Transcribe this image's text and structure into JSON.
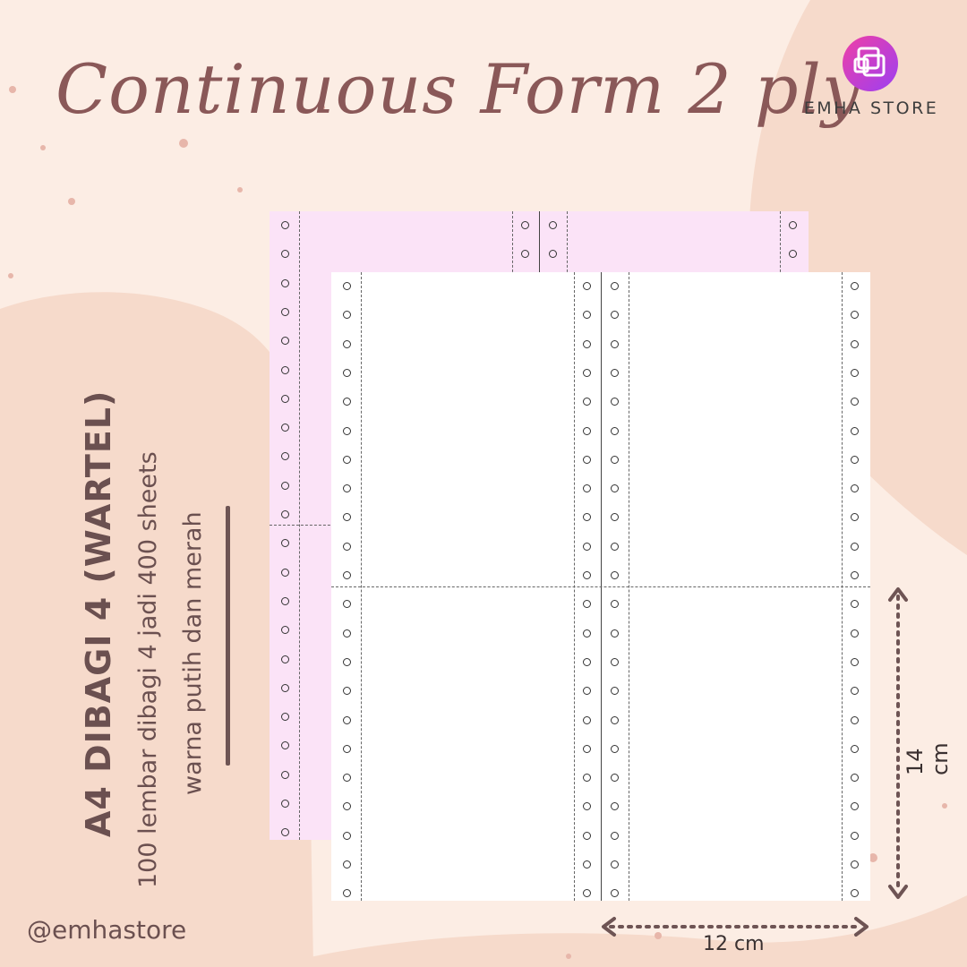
{
  "title": "Continuous Form 2 ply",
  "brand": {
    "name": "EMHA STORE",
    "logo_icon": "overlapping-squares-icon"
  },
  "headline": "A4 DIBAGI 4 (WARTEL)",
  "details": [
    "100 lembar dibagi 4 jadi 400 sheets",
    "warna putih dan merah"
  ],
  "handle": "@emhastore",
  "dimensions": {
    "height": "14 cm",
    "width": "12 cm"
  },
  "colors": {
    "background": "#fcede4",
    "blob": "#f6dacb",
    "title": "#8a5858",
    "pink_ply": "#fbe3f7",
    "white_ply": "#ffffff"
  }
}
